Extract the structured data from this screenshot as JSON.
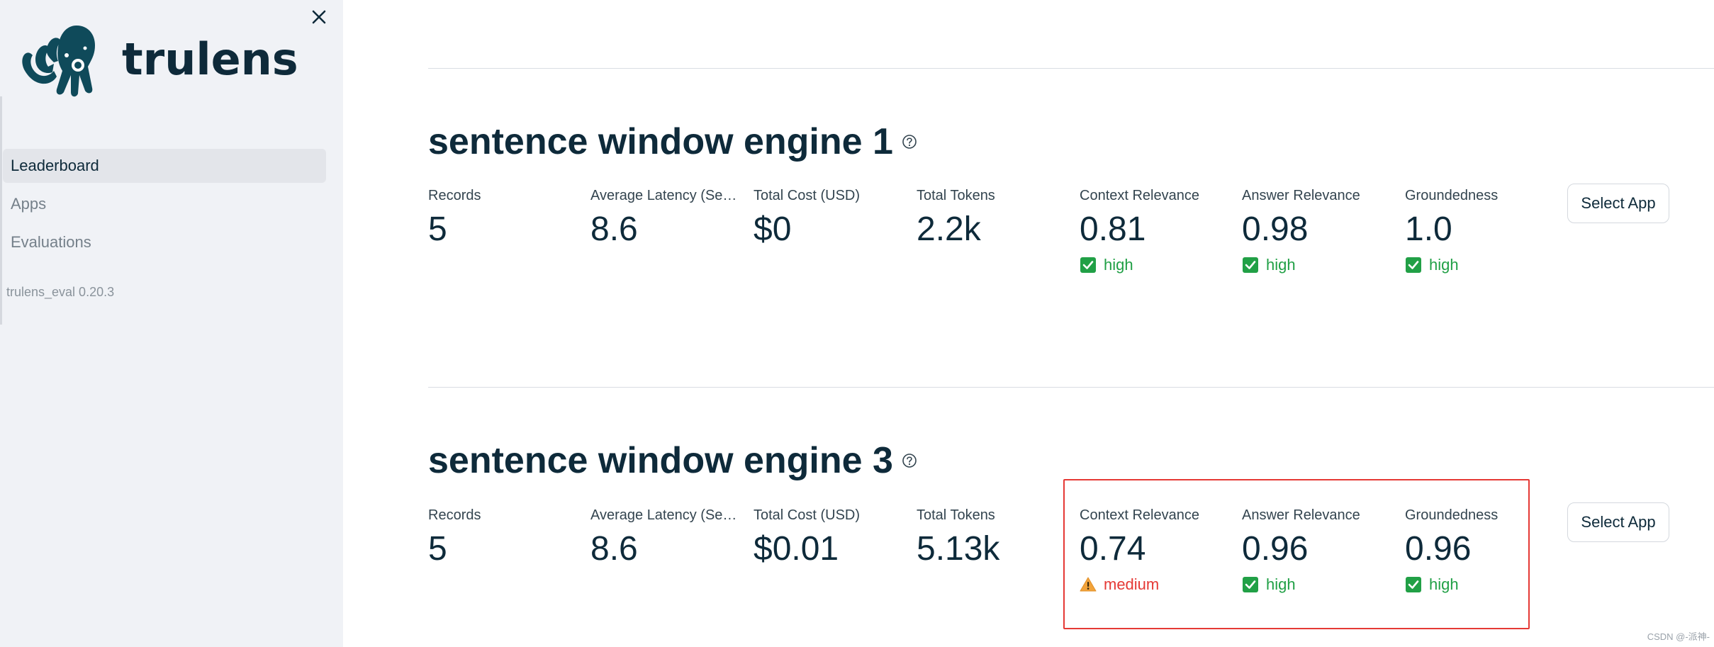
{
  "sidebar": {
    "logo_text": "trulens",
    "items": [
      {
        "label": "Leaderboard",
        "active": true
      },
      {
        "label": "Apps",
        "active": false
      },
      {
        "label": "Evaluations",
        "active": false
      }
    ],
    "version": "trulens_eval 0.20.3"
  },
  "apps": [
    {
      "title": "sentence window engine 1",
      "select_label": "Select App",
      "metrics": [
        {
          "label": "Records",
          "value": "5"
        },
        {
          "label": "Average Latency (Seconds)",
          "value": "8.6"
        },
        {
          "label": "Total Cost (USD)",
          "value": "$0"
        },
        {
          "label": "Total Tokens",
          "value": "2.2k"
        },
        {
          "label": "Context Relevance",
          "value": "0.81",
          "badge": "high"
        },
        {
          "label": "Answer Relevance",
          "value": "0.98",
          "badge": "high"
        },
        {
          "label": "Groundedness",
          "value": "1.0",
          "badge": "high"
        }
      ]
    },
    {
      "title": "sentence window engine 3",
      "select_label": "Select App",
      "metrics": [
        {
          "label": "Records",
          "value": "5"
        },
        {
          "label": "Average Latency (Seconds)",
          "value": "8.6"
        },
        {
          "label": "Total Cost (USD)",
          "value": "$0.01"
        },
        {
          "label": "Total Tokens",
          "value": "5.13k"
        },
        {
          "label": "Context Relevance",
          "value": "0.74",
          "badge": "medium"
        },
        {
          "label": "Answer Relevance",
          "value": "0.96",
          "badge": "high"
        },
        {
          "label": "Groundedness",
          "value": "0.96",
          "badge": "high"
        }
      ]
    }
  ],
  "watermark": "CSDN @-派神-",
  "colors": {
    "high": "#21a046",
    "medium": "#e53935",
    "warning": "#f2a33a",
    "sidebar_bg": "#f0f2f6"
  },
  "icons": {
    "close": "close-icon",
    "help": "help-circle-icon",
    "check": "check-square-icon",
    "warning": "warning-triangle-icon"
  }
}
